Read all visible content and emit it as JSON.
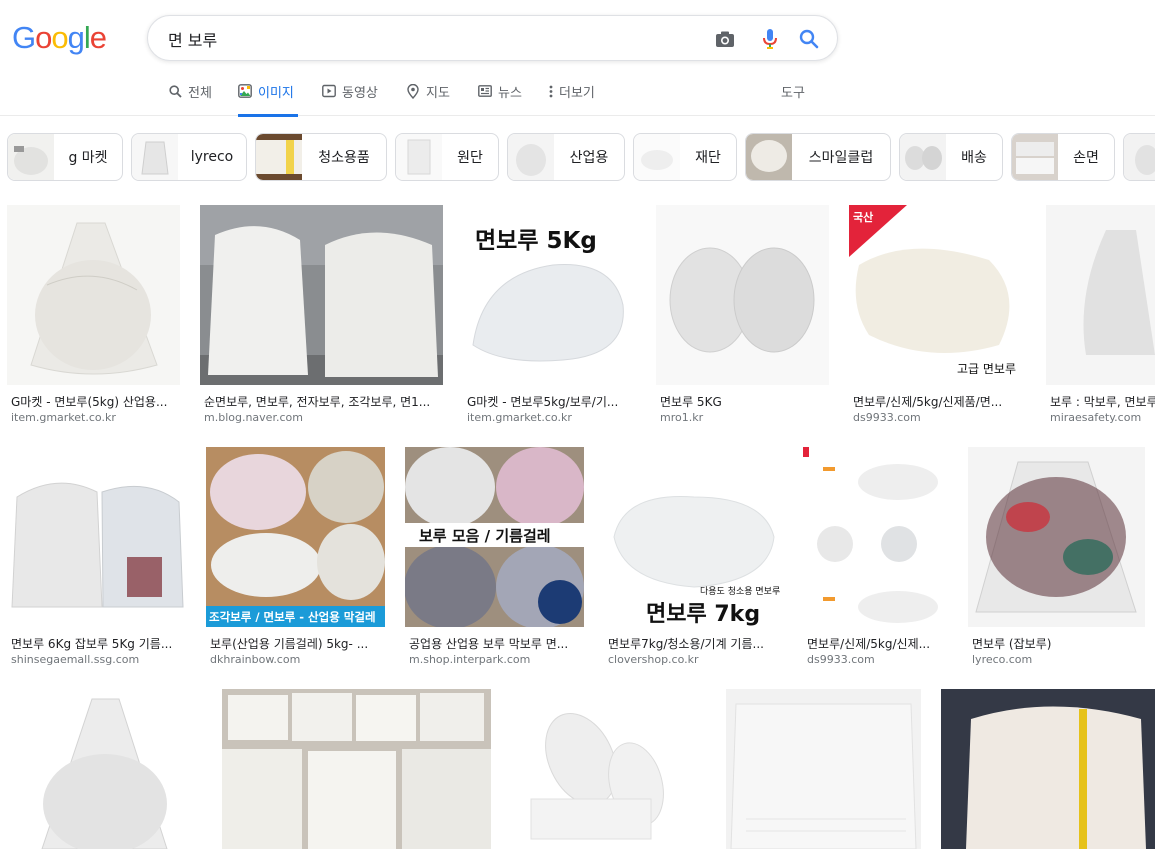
{
  "logo": {
    "letters": [
      "G",
      "o",
      "o",
      "g",
      "l",
      "e"
    ],
    "colors": [
      "#4285F4",
      "#EA4335",
      "#FBBC05",
      "#4285F4",
      "#34A853",
      "#EA4335"
    ]
  },
  "search": {
    "query": "면 보루",
    "camera_icon": "camera-icon",
    "mic_icon": "mic-icon",
    "search_icon": "search-icon"
  },
  "tabs": [
    {
      "label": "전체",
      "icon": "search-icon"
    },
    {
      "label": "이미지",
      "icon": "image-icon"
    },
    {
      "label": "동영상",
      "icon": "video-icon"
    },
    {
      "label": "지도",
      "icon": "map-pin-icon"
    },
    {
      "label": "뉴스",
      "icon": "news-icon"
    },
    {
      "label": "더보기",
      "icon": "more-vert-icon"
    }
  ],
  "tools_label": "도구",
  "chips": [
    "g 마켓",
    "lyreco",
    "청소용품",
    "원단",
    "산업용",
    "재단",
    "스마일클럽",
    "배송",
    "손면"
  ],
  "results": [
    {
      "caption": "G마켓 - 면보루(5kg) 산업용...",
      "source": "item.gmarket.co.kr"
    },
    {
      "caption": "순면보루, 면보루, 전자보루, 조각보루, 면1...",
      "source": "m.blog.naver.com"
    },
    {
      "caption": "G마켓 - 면보루5kg/보루/기...",
      "source": "item.gmarket.co.kr",
      "overlay": "면보루 5Kg"
    },
    {
      "caption": "면보루 5KG",
      "source": "mro1.kr"
    },
    {
      "caption": "면보루/신제/5kg/신제품/면...",
      "source": "ds9933.com",
      "overlay": "고급 면보루",
      "corner": "국산"
    },
    {
      "caption": "보루 : 막보루, 면보루",
      "source": "miraesafety.com"
    },
    {
      "caption": "면보루 6Kg 잡보루 5Kg 기름...",
      "source": "shinsegaemall.ssg.com"
    },
    {
      "caption": "보루(산업용 기름걸레) 5kg- ...",
      "source": "dkhrainbow.com",
      "overlay": "조각보루 / 면보루 - 산업용 막걸레"
    },
    {
      "caption": "공업용 산업용 보루 막보루 면...",
      "source": "m.shop.interpark.com",
      "overlay": "보루 모음 / 기름걸레"
    },
    {
      "caption": "면보루7kg/청소용/기계 기름...",
      "source": "clovershop.co.kr",
      "overlay": "면보루 7kg",
      "overlay_small": "다용도 청소용 면보루"
    },
    {
      "caption": "면보루/신제/5kg/신제...",
      "source": "ds9933.com"
    },
    {
      "caption": "면보루 (잡보루)",
      "source": "lyreco.com"
    },
    {
      "caption": "",
      "source": ""
    },
    {
      "caption": "",
      "source": ""
    },
    {
      "caption": "",
      "source": ""
    },
    {
      "caption": "",
      "source": ""
    },
    {
      "caption": "",
      "source": ""
    }
  ],
  "colors": {
    "accent": "#1a73e8",
    "border": "#dfe1e5",
    "secondary_text": "#70757a"
  }
}
